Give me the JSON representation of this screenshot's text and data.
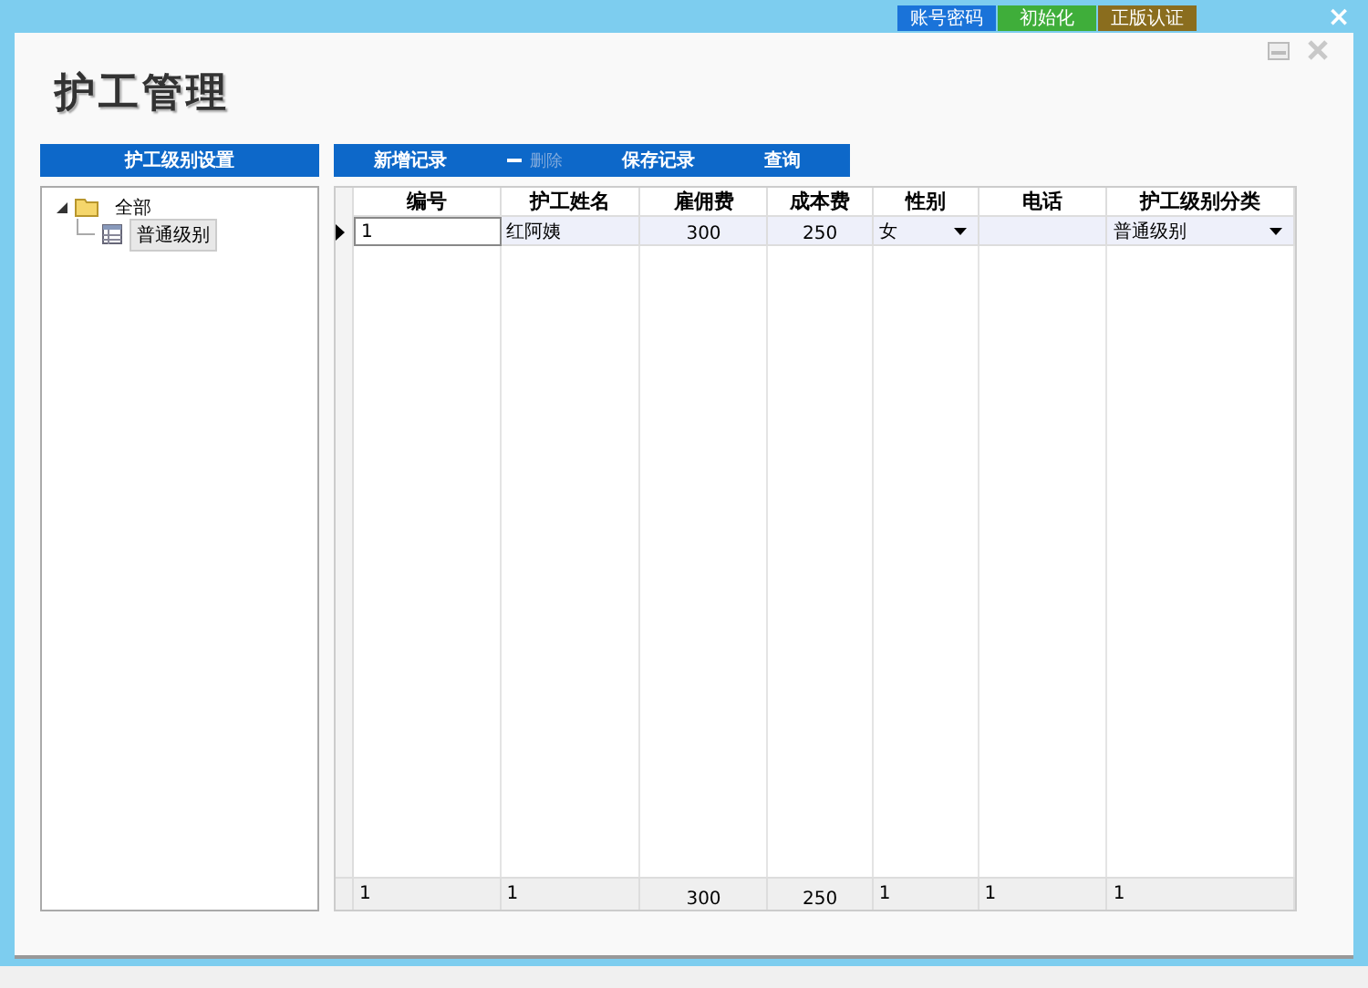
{
  "top_bar": {
    "buttons": [
      {
        "label": "账号密码",
        "color": "#1a73d9"
      },
      {
        "label": "初始化",
        "color": "#3fae3a"
      },
      {
        "label": "正版认证",
        "color": "#8a6d1e"
      }
    ],
    "close": "×"
  },
  "title": "护工管理",
  "left_panel": {
    "header": "护工级别设置",
    "tree": [
      {
        "label": "全部",
        "expanded": true,
        "selected": false,
        "children": [
          {
            "label": "普通级别",
            "selected": true
          }
        ]
      }
    ]
  },
  "toolbar": [
    {
      "label": "新增记录",
      "disabled": false,
      "kind": "plain"
    },
    {
      "label": "删除",
      "disabled": true,
      "kind": "minus"
    },
    {
      "label": "保存记录",
      "disabled": false,
      "kind": "plain"
    },
    {
      "label": "查询",
      "disabled": false,
      "kind": "plain"
    }
  ],
  "table": {
    "columns": [
      {
        "label": "编号",
        "kind": "text"
      },
      {
        "label": "护工姓名",
        "kind": "text"
      },
      {
        "label": "雇佣费",
        "kind": "number"
      },
      {
        "label": "成本费",
        "kind": "number"
      },
      {
        "label": "性别",
        "kind": "dropdown"
      },
      {
        "label": "电话",
        "kind": "text"
      },
      {
        "label": "护工级别分类",
        "kind": "dropdown"
      }
    ],
    "rows": [
      {
        "selected": true,
        "cells": [
          "1",
          "红阿姨",
          "300",
          "250",
          "女",
          "",
          "普通级别"
        ]
      }
    ],
    "footer": [
      "1",
      "1",
      "300",
      "250",
      "1",
      "1",
      "1"
    ]
  }
}
